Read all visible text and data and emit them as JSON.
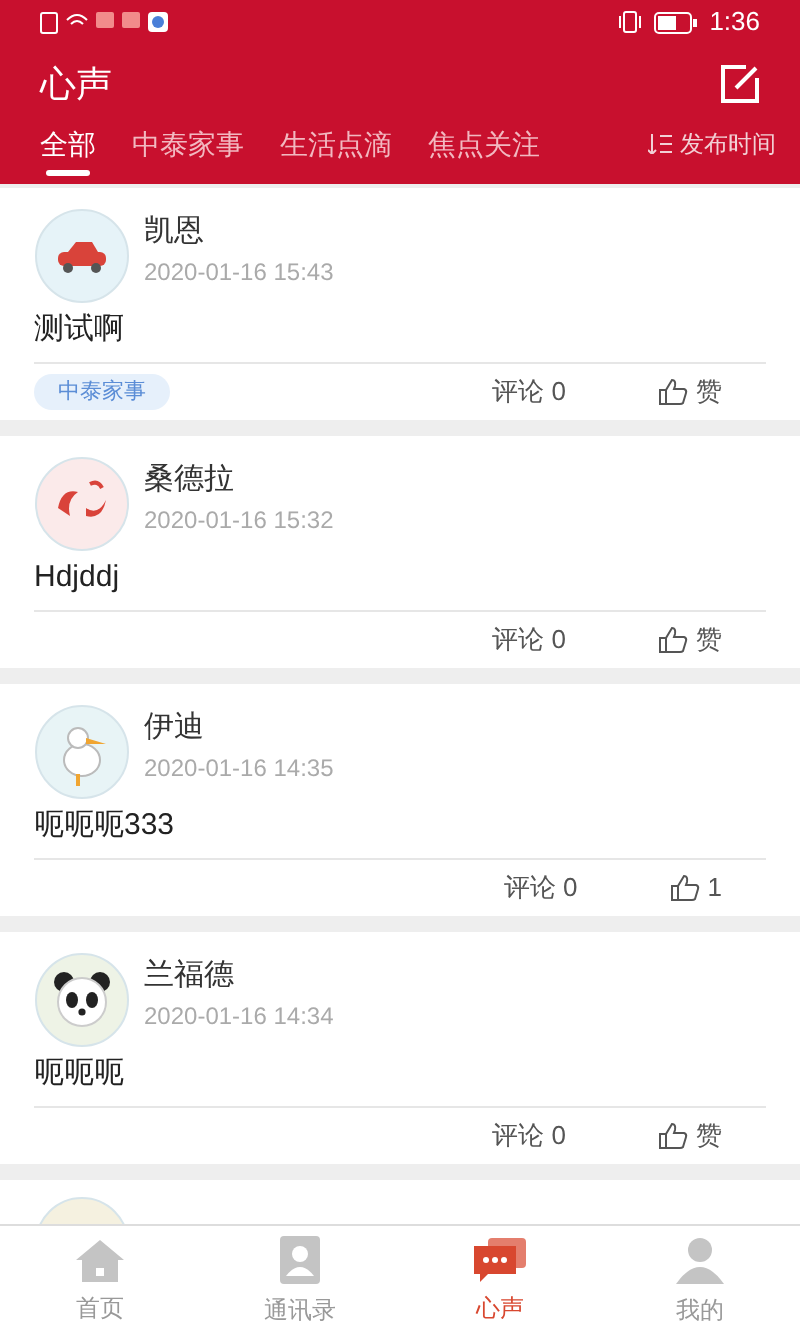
{
  "status_bar": {
    "time": "1:36"
  },
  "header": {
    "title": "心声"
  },
  "tabs": [
    {
      "label": "全部",
      "selected": true
    },
    {
      "label": "中泰家事",
      "selected": false
    },
    {
      "label": "生活点滴",
      "selected": false
    },
    {
      "label": "焦点关注",
      "selected": false
    }
  ],
  "sort": {
    "label": "发布时间"
  },
  "posts": [
    {
      "name": "凯恩",
      "time": "2020-01-16 15:43",
      "content": "测试啊",
      "tag": "中泰家事",
      "comments": "评论 0",
      "likes": "赞"
    },
    {
      "name": "桑德拉",
      "time": "2020-01-16 15:32",
      "content": "Hdjddj",
      "comments": "评论 0",
      "likes": "赞"
    },
    {
      "name": "伊迪",
      "time": "2020-01-16 14:35",
      "content": "呃呃呃333",
      "comments": "评论 0",
      "likes": "1"
    },
    {
      "name": "兰福德",
      "time": "2020-01-16 14:34",
      "content": "呃呃呃",
      "comments": "评论 0",
      "likes": "赞"
    }
  ],
  "bottom_nav": [
    {
      "label": "首页",
      "selected": false
    },
    {
      "label": "通讯录",
      "selected": false
    },
    {
      "label": "心声",
      "selected": true
    },
    {
      "label": "我的",
      "selected": false
    }
  ]
}
